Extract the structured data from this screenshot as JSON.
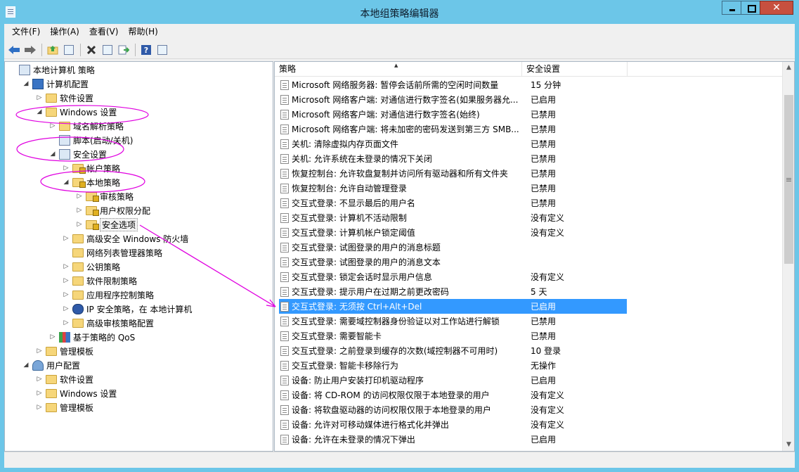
{
  "window": {
    "title": "本地组策略编辑器"
  },
  "menu": [
    "文件(F)",
    "操作(A)",
    "查看(V)",
    "帮助(H)"
  ],
  "toolbar_icons": [
    "back-icon",
    "forward-icon",
    "up-folder-icon",
    "show-hide-tree-icon",
    "delete-icon",
    "properties-icon",
    "export-icon",
    "help-icon",
    "view-icon"
  ],
  "tree": [
    {
      "label": "本地计算机 策略",
      "depth": 0,
      "exp": "",
      "icon": "doc"
    },
    {
      "label": "计算机配置",
      "depth": 1,
      "exp": "◢",
      "icon": "pc"
    },
    {
      "label": "软件设置",
      "depth": 2,
      "exp": "▷",
      "icon": "folder"
    },
    {
      "label": "Windows 设置",
      "depth": 2,
      "exp": "◢",
      "icon": "folder"
    },
    {
      "label": "域名解析策略",
      "depth": 3,
      "exp": "▷",
      "icon": "folder"
    },
    {
      "label": "脚本(启动/关机)",
      "depth": 3,
      "exp": "",
      "icon": "doc"
    },
    {
      "label": "安全设置",
      "depth": 3,
      "exp": "◢",
      "icon": "doc"
    },
    {
      "label": "帐户策略",
      "depth": 4,
      "exp": "▷",
      "icon": "folderlock"
    },
    {
      "label": "本地策略",
      "depth": 4,
      "exp": "◢",
      "icon": "folderlock"
    },
    {
      "label": "审核策略",
      "depth": 5,
      "exp": "▷",
      "icon": "folderlock"
    },
    {
      "label": "用户权限分配",
      "depth": 5,
      "exp": "▷",
      "icon": "folderlock"
    },
    {
      "label": "安全选项",
      "depth": 5,
      "exp": "▷",
      "icon": "folderlock",
      "selected": true
    },
    {
      "label": "高级安全 Windows 防火墙",
      "depth": 4,
      "exp": "▷",
      "icon": "folder"
    },
    {
      "label": "网络列表管理器策略",
      "depth": 4,
      "exp": "",
      "icon": "folder"
    },
    {
      "label": "公钥策略",
      "depth": 4,
      "exp": "▷",
      "icon": "folder"
    },
    {
      "label": "软件限制策略",
      "depth": 4,
      "exp": "▷",
      "icon": "folder"
    },
    {
      "label": "应用程序控制策略",
      "depth": 4,
      "exp": "▷",
      "icon": "folder"
    },
    {
      "label": "IP 安全策略，在 本地计算机",
      "depth": 4,
      "exp": "▷",
      "icon": "ipsec"
    },
    {
      "label": "高级审核策略配置",
      "depth": 4,
      "exp": "▷",
      "icon": "folder"
    },
    {
      "label": "基于策略的 QoS",
      "depth": 3,
      "exp": "▷",
      "icon": "qos"
    },
    {
      "label": "管理模板",
      "depth": 2,
      "exp": "▷",
      "icon": "folder"
    },
    {
      "label": "用户配置",
      "depth": 1,
      "exp": "◢",
      "icon": "user"
    },
    {
      "label": "软件设置",
      "depth": 2,
      "exp": "▷",
      "icon": "folder"
    },
    {
      "label": "Windows 设置",
      "depth": 2,
      "exp": "▷",
      "icon": "folder"
    },
    {
      "label": "管理模板",
      "depth": 2,
      "exp": "▷",
      "icon": "folder"
    }
  ],
  "columns": {
    "policy": "策略",
    "setting": "安全设置"
  },
  "rows": [
    {
      "policy": "Microsoft 网络服务器: 暂停会话前所需的空闲时间数量",
      "setting": "15 分钟"
    },
    {
      "policy": "Microsoft 网络客户端: 对通信进行数字签名(如果服务器允...",
      "setting": "已启用"
    },
    {
      "policy": "Microsoft 网络客户端: 对通信进行数字签名(始终)",
      "setting": "已禁用"
    },
    {
      "policy": "Microsoft 网络客户端: 将未加密的密码发送到第三方 SMB...",
      "setting": "已禁用"
    },
    {
      "policy": "关机: 清除虚拟内存页面文件",
      "setting": "已禁用"
    },
    {
      "policy": "关机: 允许系统在未登录的情况下关闭",
      "setting": "已禁用"
    },
    {
      "policy": "恢复控制台: 允许软盘复制并访问所有驱动器和所有文件夹",
      "setting": "已禁用"
    },
    {
      "policy": "恢复控制台: 允许自动管理登录",
      "setting": "已禁用"
    },
    {
      "policy": "交互式登录: 不显示最后的用户名",
      "setting": "已禁用"
    },
    {
      "policy": "交互式登录: 计算机不活动限制",
      "setting": "没有定义"
    },
    {
      "policy": "交互式登录: 计算机帐户锁定阈值",
      "setting": "没有定义"
    },
    {
      "policy": "交互式登录: 试图登录的用户的消息标题",
      "setting": ""
    },
    {
      "policy": "交互式登录: 试图登录的用户的消息文本",
      "setting": ""
    },
    {
      "policy": "交互式登录: 锁定会话时显示用户信息",
      "setting": "没有定义"
    },
    {
      "policy": "交互式登录: 提示用户在过期之前更改密码",
      "setting": "5 天"
    },
    {
      "policy": "交互式登录: 无须按 Ctrl+Alt+Del",
      "setting": "已启用",
      "selected": true
    },
    {
      "policy": "交互式登录: 需要域控制器身份验证以对工作站进行解锁",
      "setting": "已禁用"
    },
    {
      "policy": "交互式登录: 需要智能卡",
      "setting": "已禁用"
    },
    {
      "policy": "交互式登录: 之前登录到缓存的次数(域控制器不可用时)",
      "setting": "10 登录"
    },
    {
      "policy": "交互式登录: 智能卡移除行为",
      "setting": "无操作"
    },
    {
      "policy": "设备: 防止用户安装打印机驱动程序",
      "setting": "已启用"
    },
    {
      "policy": "设备: 将 CD-ROM 的访问权限仅限于本地登录的用户",
      "setting": "没有定义"
    },
    {
      "policy": "设备: 将软盘驱动器的访问权限仅限于本地登录的用户",
      "setting": "没有定义"
    },
    {
      "policy": "设备: 允许对可移动媒体进行格式化并弹出",
      "setting": "没有定义"
    },
    {
      "policy": "设备: 允许在未登录的情况下弹出",
      "setting": "已启用"
    }
  ],
  "annotation_color": "#e000e0"
}
